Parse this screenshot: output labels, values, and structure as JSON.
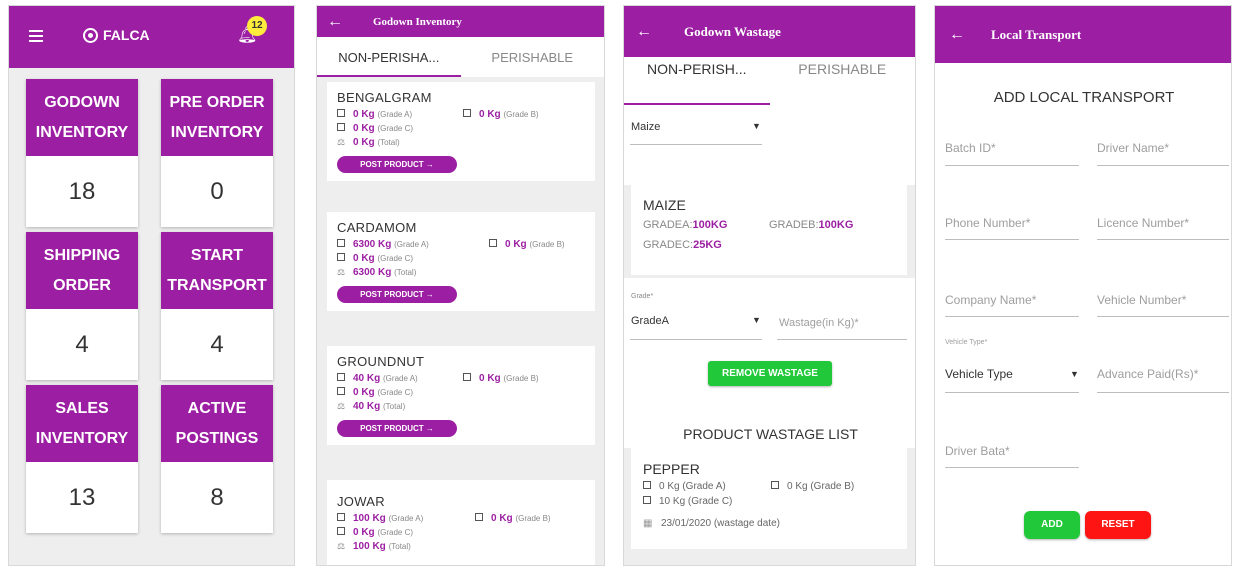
{
  "screen1": {
    "brand": "FALCA",
    "notification_count": "12",
    "tiles": [
      {
        "line1": "GODOWN",
        "line2": "INVENTORY",
        "value": "18"
      },
      {
        "line1": "PRE ORDER",
        "line2": "INVENTORY",
        "value": "0"
      },
      {
        "line1": "SHIPPING",
        "line2": "ORDER",
        "value": "4"
      },
      {
        "line1": "START",
        "line2": "TRANSPORT",
        "value": "4"
      },
      {
        "line1": "SALES",
        "line2": "INVENTORY",
        "value": "13"
      },
      {
        "line1": "ACTIVE",
        "line2": "POSTINGS",
        "value": "8"
      }
    ]
  },
  "screen2": {
    "title": "Godown Inventory",
    "tabs": [
      "NON-PERISHA...",
      "PERISHABLE"
    ],
    "post_label": "POST PRODUCT →",
    "products": [
      {
        "name": "BENGALGRAM",
        "a_qty": "0 Kg",
        "b_qty": "0 Kg",
        "c_qty": "0 Kg",
        "total": "0 Kg"
      },
      {
        "name": "CARDAMOM",
        "a_qty": "6300 Kg",
        "b_qty": "0 Kg",
        "c_qty": "0 Kg",
        "total": "6300 Kg"
      },
      {
        "name": "GROUNDNUT",
        "a_qty": "40 Kg",
        "b_qty": "0 Kg",
        "c_qty": "0 Kg",
        "total": "40 Kg"
      },
      {
        "name": "JOWAR",
        "a_qty": "100 Kg",
        "b_qty": "0 Kg",
        "c_qty": "0 Kg",
        "total": "100 Kg"
      }
    ],
    "labels": {
      "grade_a": "(Grade A)",
      "grade_b": "(Grade B)",
      "grade_c": "(Grade C)",
      "total": "(Total)"
    }
  },
  "screen3": {
    "title": "Godown Wastage",
    "tabs": [
      "NON-PERISH...",
      "PERISHABLE"
    ],
    "product_select": "Maize",
    "card": {
      "name": "MAIZE",
      "a_label": "GRADEA:",
      "a_val": "100KG",
      "b_label": "GRADEB:",
      "b_val": "100KG",
      "c_label": "GRADEC:",
      "c_val": "25KG"
    },
    "grade_label": "Grade*",
    "grade_value": "GradeA",
    "wastage_placeholder": "Wastage(in Kg)*",
    "remove_button": "REMOVE WASTAGE",
    "list_title": "PRODUCT WASTAGE LIST",
    "list_item": {
      "name": "PEPPER",
      "a": "0 Kg (Grade A)",
      "b": "0 Kg (Grade B)",
      "c": "10 Kg (Grade C)",
      "date": "23/01/2020 (wastage date)"
    }
  },
  "screen4": {
    "title": "Local Transport",
    "heading": "ADD LOCAL TRANSPORT",
    "fields": {
      "batch_id": "Batch ID*",
      "driver_name": "Driver Name*",
      "phone": "Phone Number*",
      "licence": "Licence Number*",
      "company": "Company Name*",
      "vehicle_number": "Vehicle Number*",
      "vehicle_type_label": "Vehicle Type*",
      "vehicle_type_value": "Vehicle Type",
      "advance": "Advance Paid(Rs)*",
      "driver_bata": "Driver Bata*"
    },
    "add_button": "ADD",
    "reset_button": "RESET"
  },
  "colors": {
    "primary": "#9c1fa3",
    "green": "#21c93a",
    "red": "#ff1414",
    "badge": "#ffeb3b"
  }
}
